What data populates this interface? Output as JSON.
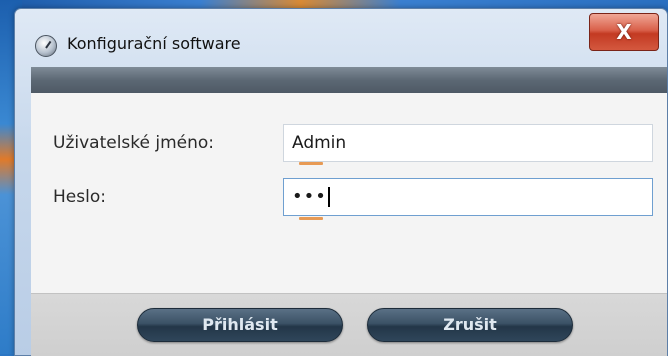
{
  "window": {
    "title": "Konfigurační software",
    "close_label": "X"
  },
  "form": {
    "username_label": "Uživatelské jméno:",
    "username_value": "Admin",
    "password_label": "Heslo:",
    "password_value": "•••"
  },
  "buttons": {
    "login_label": "Přihlásit",
    "cancel_label": "Zrušit"
  },
  "colors": {
    "header_bar": "#5c6874",
    "button": "#2f465a",
    "field_accent": "#e79a55",
    "close_button": "#c33a22"
  }
}
